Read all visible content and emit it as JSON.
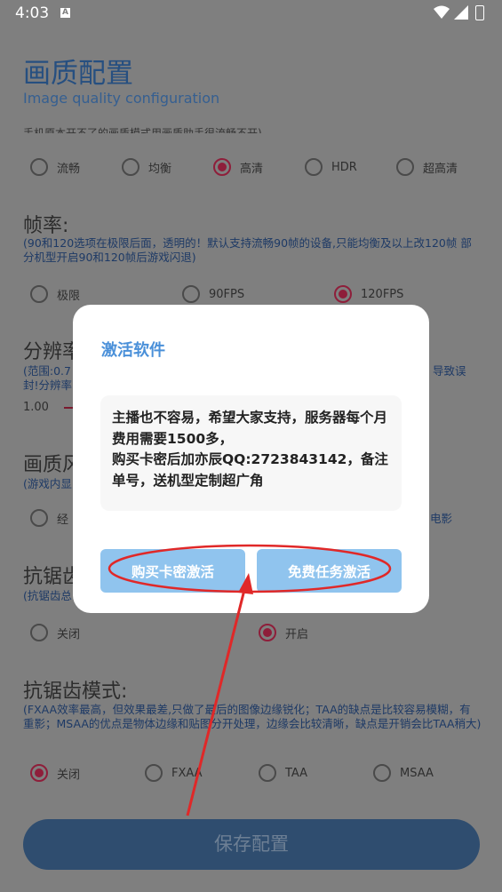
{
  "status_bar": {
    "time": "4:03",
    "badge": "A"
  },
  "header": {
    "title": "画质配置",
    "subtitle": "Image quality configuration"
  },
  "quality": {
    "clipped_desc": "手机原本开不了的画质模式用画质助手很流畅不开)",
    "options": [
      {
        "label": "流畅",
        "checked": false
      },
      {
        "label": "均衡",
        "checked": false
      },
      {
        "label": "高清",
        "checked": true
      },
      {
        "label": "HDR",
        "checked": false
      },
      {
        "label": "超高清",
        "checked": false
      }
    ]
  },
  "framerate": {
    "title": "帧率:",
    "desc": "(90和120选项在极限后面，透明的！默认支持流畅90帧的设备,只能均衡及以上改120帧 部分机型开启90和120帧后游戏闪退)",
    "options": [
      {
        "label": "极限",
        "checked": false
      },
      {
        "label": "90FPS",
        "checked": false
      },
      {
        "label": "120FPS",
        "checked": true
      }
    ]
  },
  "resolution": {
    "title": "分辨率",
    "desc_start": "(范围:0.7",
    "desc_end": "导致误",
    "desc_line2": "封!分辨率",
    "value": "1.00"
  },
  "style": {
    "title": "画质风",
    "desc": "(游戏内显",
    "opt_left": "经",
    "opt_right": "电影"
  },
  "antialias": {
    "title": "抗锯齿",
    "desc": "(抗锯齿总",
    "options": [
      {
        "label": "关闭",
        "checked": false
      },
      {
        "label": "开启",
        "checked": true
      }
    ]
  },
  "aa_mode": {
    "title": "抗锯齿模式:",
    "desc": "(FXAA效率最高，但效果最差,只做了最后的图像边缘锐化；TAA的缺点是比较容易模糊，有重影；MSAA的优点是物体边缘和贴图分开处理，边缘会比较清晰，缺点是开销会比TAA稍大)",
    "options": [
      {
        "label": "关闭",
        "checked": true
      },
      {
        "label": "FXAA",
        "checked": false
      },
      {
        "label": "TAA",
        "checked": false
      },
      {
        "label": "MSAA",
        "checked": false
      }
    ]
  },
  "save_button": "保存配置",
  "dialog": {
    "title": "激活软件",
    "message": "主播也不容易，希望大家支持，服务器每个月费用需要1500多，\n购买卡密后加亦辰QQ:2723843142，备注单号，送机型定制超广角",
    "buy_button": "购买卡密激活",
    "free_button": "免费任务激活"
  },
  "colors": {
    "overlay": "#7f7f7f",
    "accent_checked": "#8e1e3a",
    "dialog_button": "#90c4ee",
    "annotation": "#e02828"
  }
}
